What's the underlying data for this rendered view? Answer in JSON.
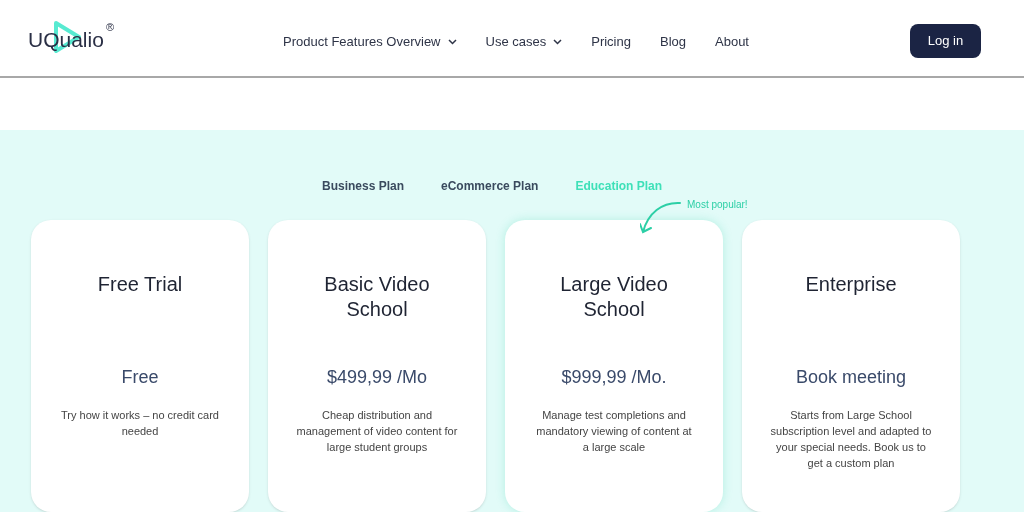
{
  "header": {
    "logo": {
      "text": "UQualio",
      "mark": "®"
    },
    "nav": [
      {
        "label": "Product Features Overview",
        "dropdown": true
      },
      {
        "label": "Use cases",
        "dropdown": true
      },
      {
        "label": "Pricing",
        "dropdown": false
      },
      {
        "label": "Blog",
        "dropdown": false
      },
      {
        "label": "About",
        "dropdown": false
      }
    ],
    "login_button": "Log in"
  },
  "plan_tabs": [
    {
      "label": "Business Plan",
      "selected": false
    },
    {
      "label": "eCommerce Plan",
      "selected": false
    },
    {
      "label": "Education Plan",
      "selected": true
    }
  ],
  "popular_note": "Most popular!",
  "plans": [
    {
      "title": "Free Trial",
      "price": "Free",
      "description": "Try how it works – no credit card needed",
      "popular": false
    },
    {
      "title": "Basic Video School",
      "price": "$499,99 /Mo",
      "description": "Cheap distribution and management of video content for large student groups",
      "popular": false
    },
    {
      "title": "Large Video School",
      "price": "$999,99 /Mo.",
      "description": "Manage test completions and mandatory viewing of content at a large scale",
      "popular": true
    },
    {
      "title": "Enterprise",
      "price": "Book meeting",
      "description": "Starts from Large School subscription level and adapted to your special needs. Book us to get a custom plan",
      "popular": false
    }
  ]
}
